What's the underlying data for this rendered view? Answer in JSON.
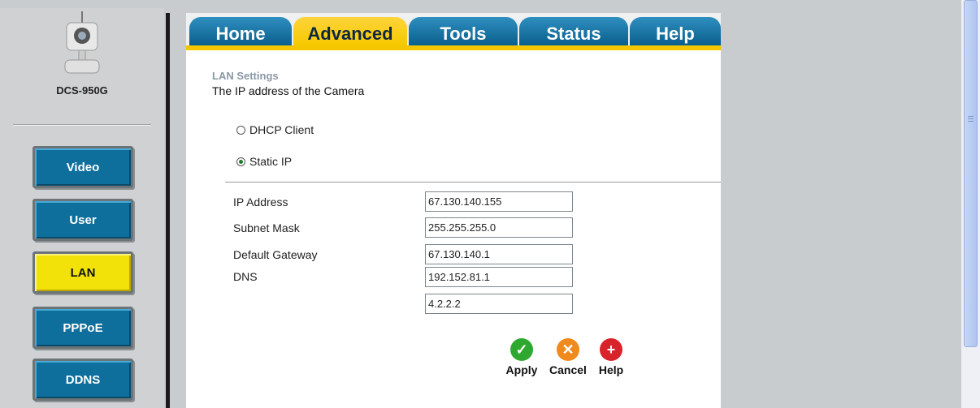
{
  "sidebar": {
    "model": "DCS-950G",
    "buttons": [
      {
        "label": "Video",
        "active": false
      },
      {
        "label": "User",
        "active": false
      },
      {
        "label": "LAN",
        "active": true
      },
      {
        "label": "PPPoE",
        "active": false
      },
      {
        "label": "DDNS",
        "active": false
      }
    ]
  },
  "tabs": [
    {
      "label": "Home",
      "active": false
    },
    {
      "label": "Advanced",
      "active": true
    },
    {
      "label": "Tools",
      "active": false
    },
    {
      "label": "Status",
      "active": false
    },
    {
      "label": "Help",
      "active": false
    }
  ],
  "lan": {
    "title": "LAN Settings",
    "description": "The IP address of the Camera",
    "options": [
      {
        "label": "DHCP Client",
        "checked": false
      },
      {
        "label": "Static IP",
        "checked": true
      }
    ],
    "fields": {
      "ip_label": "IP Address",
      "ip_value": "67.130.140.155",
      "subnet_label": "Subnet Mask",
      "subnet_value": "255.255.255.0",
      "gateway_label": "Default Gateway",
      "gateway_value": "67.130.140.1",
      "dns_label": "DNS",
      "dns1_value": "192.152.81.1",
      "dns2_value": "4.2.2.2"
    }
  },
  "actions": [
    {
      "label": "Apply",
      "icon": "check-icon",
      "color": "#2fa82f"
    },
    {
      "label": "Cancel",
      "icon": "x-icon",
      "color": "#f08a1c"
    },
    {
      "label": "Help",
      "icon": "plus-icon",
      "color": "#d9232a"
    }
  ],
  "colors": {
    "tab_blue": "#0e6f9d",
    "tab_active": "#f6c800",
    "side_active": "#f2e20a"
  }
}
